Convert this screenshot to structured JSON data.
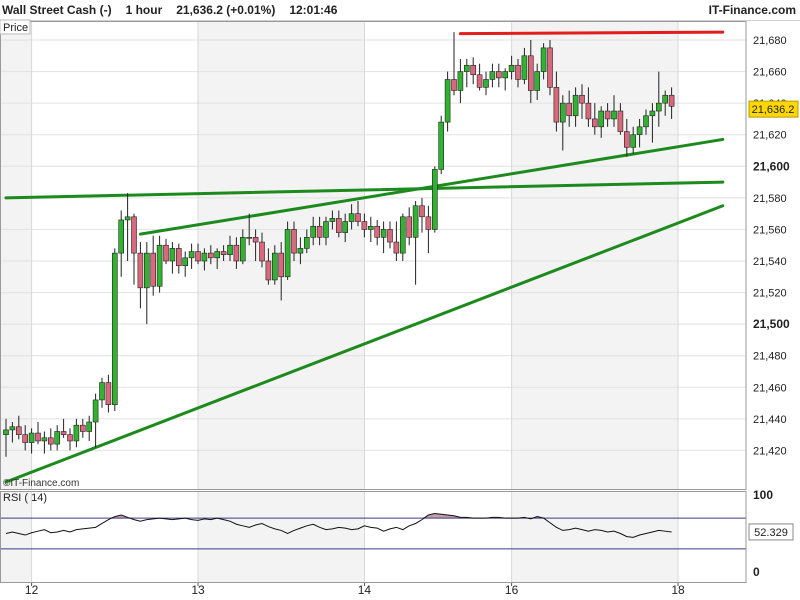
{
  "header": {
    "symbol": "Wall Street Cash (-)",
    "timeframe": "1 hour",
    "price": "21,636.2 (+0.01%)",
    "time": "12:01:46",
    "brand": "IT-Finance.com"
  },
  "panels": {
    "price_label": "Price",
    "rsi_label": "RSI ( 14)",
    "watermark": "©IT-Finance.com"
  },
  "colors": {
    "bull": "#31b231",
    "bear": "#d9687c",
    "trendline": "#1d8a1d",
    "resistance": "#e31c1c",
    "rsi_line": "#111111",
    "rsi_band": "#3a3a8a",
    "rsi_fill": "#c59aa8",
    "price_tag": "#ffd700"
  },
  "chart_data": [
    {
      "type": "candlestick",
      "title": "Wall Street Cash (-) 1 hour",
      "ylabel": "Price",
      "ylim": [
        21400,
        21690
      ],
      "yticks": [
        21420,
        21440,
        21460,
        21480,
        21500,
        21520,
        21540,
        21560,
        21580,
        21600,
        21620,
        21640,
        21660,
        21680
      ],
      "ytick_labels": [
        "21,420",
        "21,440",
        "21,460",
        "21,480",
        "21,500",
        "21,520",
        "21,540",
        "21,560",
        "21,580",
        "21,600",
        "21,620",
        "21,640",
        "21,660",
        "21,680"
      ],
      "xtick_labels": [
        "12",
        "13",
        "14",
        "16",
        "18"
      ],
      "xtick_index": [
        4,
        30,
        56,
        79,
        105
      ],
      "last_price": "21,636.2",
      "grid": true,
      "candles": [
        [
          21430,
          21440,
          21416,
          21433
        ],
        [
          21433,
          21438,
          21425,
          21435
        ],
        [
          21435,
          21442,
          21427,
          21430
        ],
        [
          21430,
          21436,
          21420,
          21425
        ],
        [
          21425,
          21434,
          21418,
          21431
        ],
        [
          21431,
          21438,
          21424,
          21426
        ],
        [
          21426,
          21432,
          21418,
          21428
        ],
        [
          21428,
          21434,
          21420,
          21424
        ],
        [
          21424,
          21436,
          21420,
          21432
        ],
        [
          21432,
          21440,
          21428,
          21430
        ],
        [
          21430,
          21434,
          21420,
          21426
        ],
        [
          21426,
          21440,
          21422,
          21436
        ],
        [
          21436,
          21440,
          21428,
          21432
        ],
        [
          21432,
          21442,
          21426,
          21438
        ],
        [
          21438,
          21456,
          21422,
          21452
        ],
        [
          21452,
          21466,
          21447,
          21463
        ],
        [
          21463,
          21468,
          21444,
          21449
        ],
        [
          21449,
          21548,
          21445,
          21545
        ],
        [
          21545,
          21572,
          21530,
          21566
        ],
        [
          21566,
          21583,
          21540,
          21568
        ],
        [
          21568,
          21570,
          21525,
          21545
        ],
        [
          21545,
          21552,
          21510,
          21523
        ],
        [
          21523,
          21552,
          21500,
          21545
        ],
        [
          21545,
          21556,
          21518,
          21524
        ],
        [
          21524,
          21556,
          21520,
          21550
        ],
        [
          21550,
          21554,
          21538,
          21540
        ],
        [
          21540,
          21552,
          21532,
          21548
        ],
        [
          21548,
          21551,
          21532,
          21537
        ],
        [
          21537,
          21546,
          21530,
          21542
        ],
        [
          21542,
          21551,
          21535,
          21546
        ],
        [
          21546,
          21551,
          21538,
          21540
        ],
        [
          21540,
          21548,
          21534,
          21545
        ],
        [
          21545,
          21550,
          21538,
          21542
        ],
        [
          21542,
          21548,
          21535,
          21546
        ],
        [
          21546,
          21550,
          21540,
          21544
        ],
        [
          21544,
          21556,
          21540,
          21550
        ],
        [
          21550,
          21555,
          21535,
          21540
        ],
        [
          21540,
          21560,
          21538,
          21555
        ],
        [
          21555,
          21570,
          21550,
          21555
        ],
        [
          21555,
          21560,
          21540,
          21552
        ],
        [
          21552,
          21558,
          21536,
          21540
        ],
        [
          21540,
          21548,
          21525,
          21528
        ],
        [
          21528,
          21550,
          21525,
          21545
        ],
        [
          21545,
          21552,
          21515,
          21530
        ],
        [
          21530,
          21565,
          21528,
          21560
        ],
        [
          21560,
          21565,
          21540,
          21545
        ],
        [
          21545,
          21555,
          21538,
          21548
        ],
        [
          21548,
          21560,
          21545,
          21555
        ],
        [
          21555,
          21568,
          21550,
          21562
        ],
        [
          21562,
          21568,
          21550,
          21555
        ],
        [
          21555,
          21568,
          21550,
          21565
        ],
        [
          21565,
          21572,
          21560,
          21567
        ],
        [
          21567,
          21572,
          21555,
          21558
        ],
        [
          21558,
          21570,
          21552,
          21565
        ],
        [
          21565,
          21576,
          21560,
          21570
        ],
        [
          21570,
          21578,
          21562,
          21565
        ],
        [
          21565,
          21570,
          21555,
          21560
        ],
        [
          21560,
          21568,
          21552,
          21562
        ],
        [
          21562,
          21566,
          21550,
          21555
        ],
        [
          21555,
          21565,
          21545,
          21560
        ],
        [
          21560,
          21565,
          21548,
          21552
        ],
        [
          21552,
          21565,
          21540,
          21545
        ],
        [
          21545,
          21570,
          21540,
          21568
        ],
        [
          21568,
          21574,
          21550,
          21555
        ],
        [
          21555,
          21578,
          21525,
          21575
        ],
        [
          21575,
          21580,
          21558,
          21568
        ],
        [
          21568,
          21575,
          21545,
          21560
        ],
        [
          21560,
          21600,
          21558,
          21598
        ],
        [
          21598,
          21632,
          21595,
          21628
        ],
        [
          21628,
          21660,
          21622,
          21655
        ],
        [
          21655,
          21685,
          21645,
          21648
        ],
        [
          21648,
          21668,
          21640,
          21660
        ],
        [
          21660,
          21668,
          21650,
          21664
        ],
        [
          21664,
          21669,
          21652,
          21658
        ],
        [
          21658,
          21665,
          21648,
          21650
        ],
        [
          21650,
          21660,
          21645,
          21655
        ],
        [
          21655,
          21665,
          21650,
          21660
        ],
        [
          21660,
          21665,
          21650,
          21656
        ],
        [
          21656,
          21662,
          21648,
          21660
        ],
        [
          21660,
          21670,
          21655,
          21664
        ],
        [
          21664,
          21668,
          21650,
          21655
        ],
        [
          21655,
          21675,
          21652,
          21670
        ],
        [
          21670,
          21680,
          21640,
          21648
        ],
        [
          21648,
          21665,
          21642,
          21660
        ],
        [
          21660,
          21678,
          21655,
          21675
        ],
        [
          21675,
          21680,
          21645,
          21650
        ],
        [
          21650,
          21660,
          21622,
          21628
        ],
        [
          21628,
          21645,
          21610,
          21640
        ],
        [
          21640,
          21648,
          21625,
          21632
        ],
        [
          21632,
          21650,
          21625,
          21645
        ],
        [
          21645,
          21652,
          21630,
          21640
        ],
        [
          21640,
          21650,
          21625,
          21630
        ],
        [
          21630,
          21640,
          21620,
          21625
        ],
        [
          21625,
          21638,
          21618,
          21635
        ],
        [
          21635,
          21640,
          21625,
          21630
        ],
        [
          21630,
          21645,
          21625,
          21635
        ],
        [
          21635,
          21640,
          21620,
          21622
        ],
        [
          21622,
          21630,
          21606,
          21612
        ],
        [
          21612,
          21625,
          21608,
          21620
        ],
        [
          21620,
          21630,
          21612,
          21625
        ],
        [
          21625,
          21636,
          21620,
          21632
        ],
        [
          21632,
          21640,
          21615,
          21635
        ],
        [
          21635,
          21660,
          21625,
          21640
        ],
        [
          21640,
          21648,
          21632,
          21645
        ],
        [
          21645,
          21650,
          21630,
          21638
        ]
      ],
      "trendlines": [
        {
          "color": "resistance",
          "from": [
            71,
            21684
          ],
          "to": [
            112,
            21685
          ]
        },
        {
          "color": "trendline",
          "from": [
            0,
            21580
          ],
          "to": [
            112,
            21590
          ]
        },
        {
          "color": "trendline",
          "from": [
            21,
            21557
          ],
          "to": [
            112,
            21617
          ]
        },
        {
          "color": "trendline",
          "from": [
            0,
            21400
          ],
          "to": [
            112,
            21575
          ]
        }
      ]
    },
    {
      "type": "line",
      "title": "RSI ( 14)",
      "ylim": [
        0,
        100
      ],
      "yticks": [
        0,
        100
      ],
      "ytick_labels": [
        "0",
        "100"
      ],
      "bands": [
        70,
        30
      ],
      "last_value": "52.329",
      "values": [
        50,
        52,
        50,
        48,
        51,
        53,
        55,
        51,
        52,
        54,
        52,
        55,
        56,
        57,
        58,
        63,
        68,
        72,
        74,
        71,
        68,
        66,
        68,
        69,
        70,
        69,
        68,
        69,
        70,
        68,
        67,
        69,
        68,
        70,
        68,
        66,
        62,
        60,
        58,
        61,
        63,
        59,
        56,
        54,
        50,
        54,
        57,
        60,
        62,
        58,
        55,
        56,
        58,
        57,
        55,
        56,
        60,
        58,
        57,
        53,
        56,
        58,
        55,
        60,
        63,
        68,
        74,
        76,
        75,
        74,
        73,
        71,
        71,
        70,
        70,
        70,
        71,
        71,
        70,
        70,
        70,
        71,
        69,
        72,
        70,
        64,
        58,
        54,
        55,
        57,
        55,
        53,
        55,
        54,
        52,
        53,
        50,
        46,
        45,
        48,
        50,
        52,
        54,
        53,
        52
      ]
    }
  ]
}
